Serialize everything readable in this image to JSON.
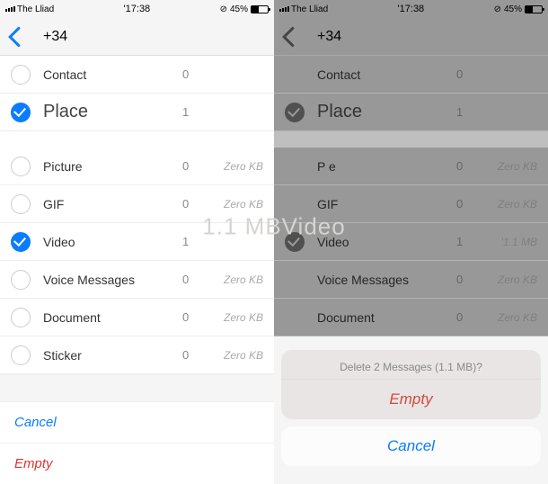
{
  "statusbar": {
    "carrier": "The Lliad",
    "time": "'17:38",
    "battery": "45%"
  },
  "nav": {
    "title": "+34"
  },
  "left": {
    "group1": [
      {
        "label": "Contact",
        "count": "0",
        "size": "",
        "checked": false,
        "big": false
      },
      {
        "label": "Place",
        "count": "1",
        "size": "",
        "checked": true,
        "big": true
      }
    ],
    "group2": [
      {
        "label": "Picture",
        "count": "0",
        "size": "Zero KB"
      },
      {
        "label": "GIF",
        "count": "0",
        "size": "Zero KB"
      },
      {
        "label": "Video",
        "count": "1",
        "size": ""
      },
      {
        "label": "Voice Messages",
        "count": "0",
        "size": "Zero KB"
      },
      {
        "label": "Document",
        "count": "0",
        "size": "Zero KB"
      },
      {
        "label": "Sticker",
        "count": "0",
        "size": "Zero KB"
      }
    ],
    "footer": {
      "cancel": "Cancel",
      "empty": "Empty"
    }
  },
  "right": {
    "group1": [
      {
        "label": "Contact",
        "count": "0"
      },
      {
        "label": "Place",
        "count": "1"
      }
    ],
    "group2": [
      {
        "label": "P   e",
        "count": "0",
        "size": "Zero KB"
      },
      {
        "label": "GIF",
        "count": "0",
        "size": "Zero KB"
      },
      {
        "label": "Video",
        "count": "1",
        "size": "'1.1 MB"
      },
      {
        "label": "Voice Messages",
        "count": "0",
        "size": "Zero KB"
      },
      {
        "label": "Document",
        "count": "0",
        "size": "Zero KB"
      }
    ]
  },
  "overlay_label": "1.1 MBVideo",
  "sheet": {
    "header": "Delete 2 Messages (1.1 MB)?",
    "empty": "Empty",
    "cancel": "Cancel"
  }
}
